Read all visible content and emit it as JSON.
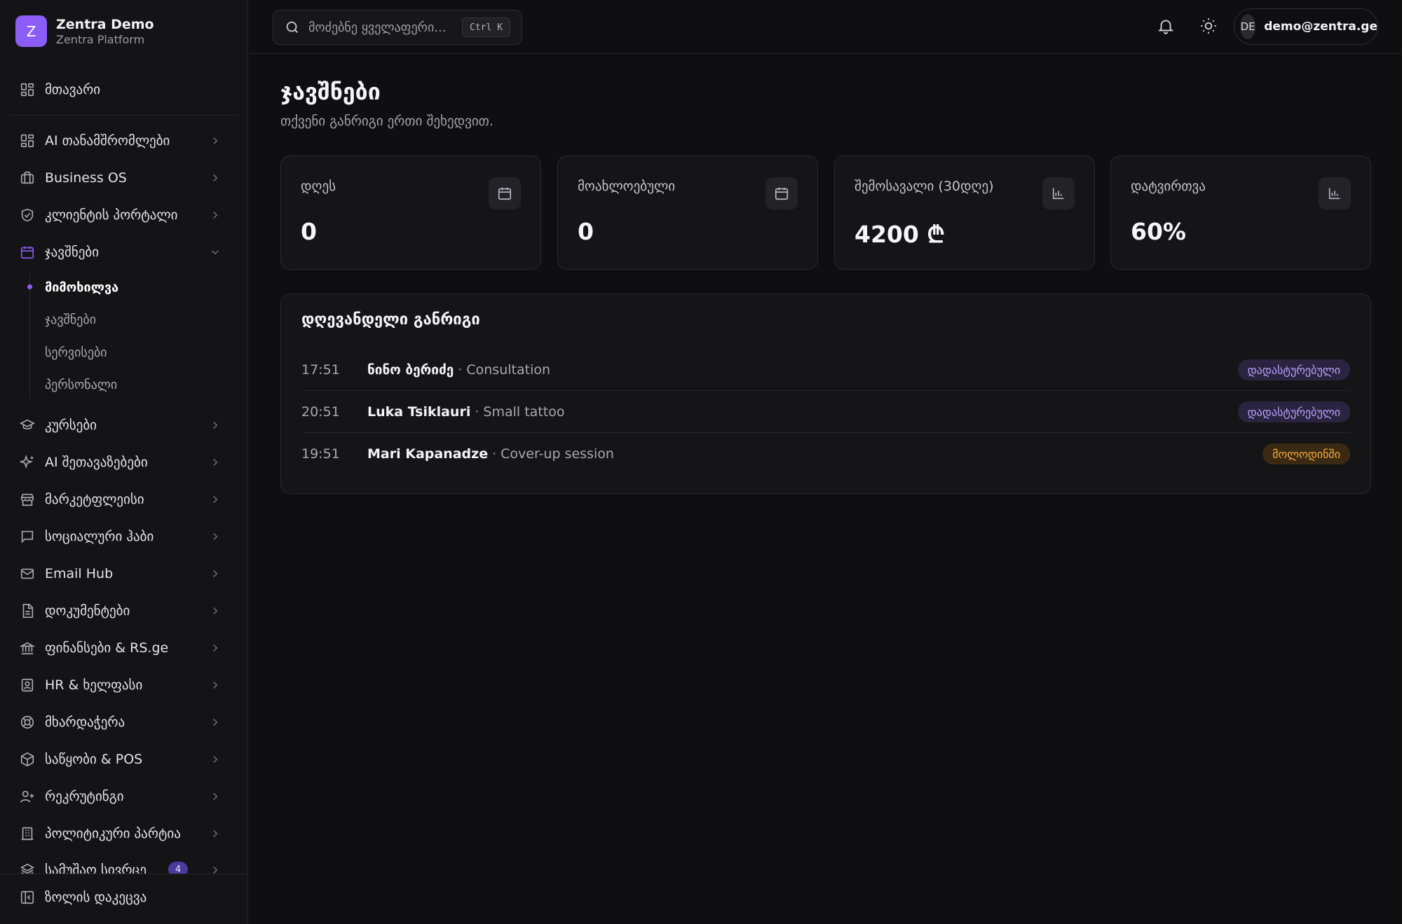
{
  "brand": {
    "logo_letter": "Z",
    "title": "Zentra Demo",
    "subtitle": "Zentra Platform",
    "accent": "#8b5cf6"
  },
  "sidebar": {
    "home": {
      "label": "მთავარი",
      "icon": "grid-icon"
    },
    "items": [
      {
        "label": "AI თანამშრომლები",
        "icon": "grid-icon"
      },
      {
        "label": "Business OS",
        "icon": "briefcase-icon"
      },
      {
        "label": "კლიენტის პორტალი",
        "icon": "shield-icon"
      },
      {
        "label": "ჯავშნები",
        "icon": "calendar-icon",
        "expanded": true
      },
      {
        "label": "კურსები",
        "icon": "graduation-cap-icon"
      },
      {
        "label": "AI შეთავაზებები",
        "icon": "sparkles-icon"
      },
      {
        "label": "მარკეტფლეისი",
        "icon": "store-icon"
      },
      {
        "label": "სოციალური ჰაბი",
        "icon": "message-square-icon"
      },
      {
        "label": "Email Hub",
        "icon": "mail-icon"
      },
      {
        "label": "დოკუმენტები",
        "icon": "file-text-icon"
      },
      {
        "label": "ფინანსები & RS.ge",
        "icon": "bank-icon"
      },
      {
        "label": "HR & ხელფასი",
        "icon": "id-badge-icon"
      },
      {
        "label": "მხარდაჭერა",
        "icon": "life-buoy-icon"
      },
      {
        "label": "საწყობი & POS",
        "icon": "package-icon"
      },
      {
        "label": "რეკრუტინგი",
        "icon": "user-plus-icon"
      },
      {
        "label": "პოლიტიკური პარტია",
        "icon": "building-icon"
      },
      {
        "label": "სამუშაო სივრცე",
        "icon": "layers-icon",
        "badge": "4"
      }
    ],
    "sub_items": [
      {
        "label": "მიმოხილვა",
        "active": true
      },
      {
        "label": "ჯავშნები",
        "active": false
      },
      {
        "label": "სერვისები",
        "active": false
      },
      {
        "label": "პერსონალი",
        "active": false
      }
    ],
    "collapse_label": "ზოლის დაკეცვა"
  },
  "topbar": {
    "search_placeholder": "მოძებნე ყველაფერი...",
    "search_shortcut": "Ctrl K",
    "user_initials": "DE",
    "user_email": "demo@zentra.ge"
  },
  "page": {
    "title": "ჯავშნები",
    "subtitle": "თქვენი განრიგი ერთი შეხედვით."
  },
  "stats": [
    {
      "label": "დღეს",
      "value": "0",
      "icon": "calendar-icon"
    },
    {
      "label": "მოახლოებული",
      "value": "0",
      "icon": "calendar-icon"
    },
    {
      "label": "შემოსავალი (30დღე)",
      "value": "4200 ₾",
      "icon": "bar-chart-icon"
    },
    {
      "label": "დატვირთვა",
      "value": "60%",
      "icon": "bar-chart-icon"
    }
  ],
  "schedule": {
    "title": "დღევანდელი განრიგი",
    "appointments": [
      {
        "time": "17:51",
        "client": "ნინო ბერიძე",
        "service": "Consultation",
        "status": "დადასტურებული",
        "status_type": "confirmed"
      },
      {
        "time": "20:51",
        "client": "Luka Tsiklauri",
        "service": "Small tattoo",
        "status": "დადასტურებული",
        "status_type": "confirmed"
      },
      {
        "time": "19:51",
        "client": "Mari Kapanadze",
        "service": "Cover-up session",
        "status": "მოლოდინში",
        "status_type": "pending"
      }
    ],
    "separator": "·"
  }
}
